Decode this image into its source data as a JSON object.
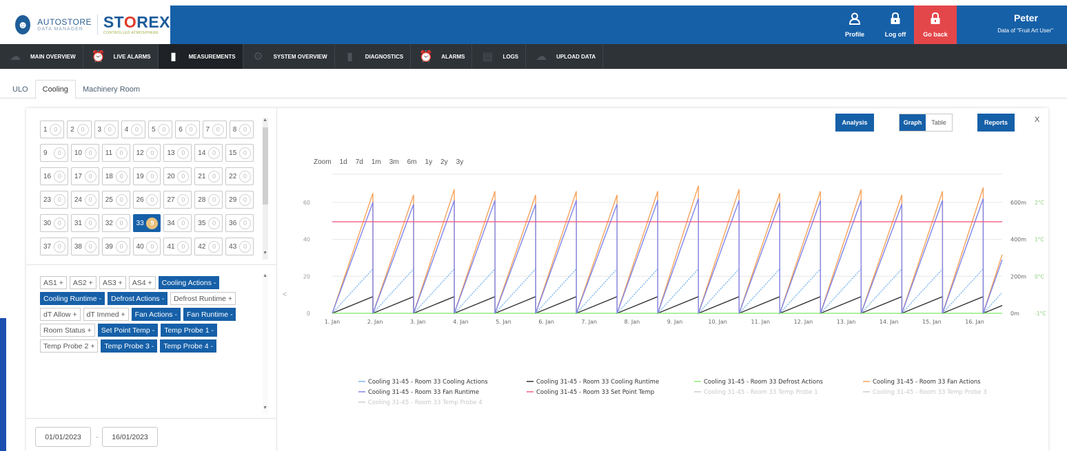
{
  "header": {
    "logo_badge": "☻",
    "logo_main": "AUTOSTORE",
    "logo_sub": "DATA MANAGER",
    "storex_pre": "ST",
    "storex_o": "O",
    "storex_post": "REX",
    "storex_sub": "CONTROLLED ATMOSPHERE",
    "buttons": [
      {
        "label": "Profile",
        "icon": "user-icon"
      },
      {
        "label": "Log off",
        "icon": "lock-icon"
      },
      {
        "label": "Go back",
        "icon": "lock-icon"
      }
    ],
    "user_name": "Peter",
    "user_data": "Data of \"Fruit Art User\"",
    "colors": {
      "brand": "#1660a8",
      "danger": "#e4474a",
      "nav": "#2e3338"
    }
  },
  "nav": [
    {
      "label": "MAIN OVERVIEW",
      "icon": "cloud-icon"
    },
    {
      "label": "LIVE ALARMS",
      "icon": "alarm-clock-icon"
    },
    {
      "label": "MEASUREMENTS",
      "icon": "bar-chart-icon",
      "active": true
    },
    {
      "label": "SYSTEM OVERVIEW",
      "icon": "gear-icon"
    },
    {
      "label": "DIAGNOSTICS",
      "icon": "bar-chart-icon"
    },
    {
      "label": "ALARMS",
      "icon": "alarm-clock-icon"
    },
    {
      "label": "LOGS",
      "icon": "document-icon"
    },
    {
      "label": "UPLOAD DATA",
      "icon": "cloud-upload-icon"
    }
  ],
  "subtabs": [
    {
      "label": "ULO"
    },
    {
      "label": "Cooling",
      "active": true
    },
    {
      "label": "Machinery Room"
    }
  ],
  "rooms": [
    [
      {
        "n": "1",
        "c": "0"
      },
      {
        "n": "2",
        "c": "0"
      },
      {
        "n": "3",
        "c": "0"
      },
      {
        "n": "4",
        "c": "0"
      },
      {
        "n": "5",
        "c": "0"
      },
      {
        "n": "6",
        "c": "0"
      },
      {
        "n": "7",
        "c": "0"
      },
      {
        "n": "8",
        "c": "0"
      }
    ],
    [
      {
        "n": "9",
        "c": "0"
      },
      {
        "n": "10",
        "c": "0"
      },
      {
        "n": "11",
        "c": "0"
      },
      {
        "n": "12",
        "c": "0"
      },
      {
        "n": "13",
        "c": "0"
      },
      {
        "n": "14",
        "c": "0"
      },
      {
        "n": "15",
        "c": "0"
      }
    ],
    [
      {
        "n": "16",
        "c": "0"
      },
      {
        "n": "17",
        "c": "0"
      },
      {
        "n": "18",
        "c": "0"
      },
      {
        "n": "19",
        "c": "0"
      },
      {
        "n": "20",
        "c": "0"
      },
      {
        "n": "21",
        "c": "0"
      },
      {
        "n": "22",
        "c": "0"
      }
    ],
    [
      {
        "n": "23",
        "c": "0"
      },
      {
        "n": "24",
        "c": "0"
      },
      {
        "n": "25",
        "c": "0"
      },
      {
        "n": "26",
        "c": "0"
      },
      {
        "n": "27",
        "c": "0"
      },
      {
        "n": "28",
        "c": "0"
      },
      {
        "n": "29",
        "c": "0"
      }
    ],
    [
      {
        "n": "30",
        "c": "0"
      },
      {
        "n": "31",
        "c": "0"
      },
      {
        "n": "32",
        "c": "0"
      },
      {
        "n": "33",
        "c": "9",
        "selected": true
      },
      {
        "n": "34",
        "c": "0"
      },
      {
        "n": "35",
        "c": "0"
      },
      {
        "n": "36",
        "c": "0"
      }
    ],
    [
      {
        "n": "37",
        "c": "0"
      },
      {
        "n": "38",
        "c": "0"
      },
      {
        "n": "39",
        "c": "0"
      },
      {
        "n": "40",
        "c": "0"
      },
      {
        "n": "41",
        "c": "0"
      },
      {
        "n": "42",
        "c": "0"
      },
      {
        "n": "43",
        "c": "0"
      }
    ],
    [
      {
        "n": "44",
        "c": "0"
      },
      {
        "n": "45",
        "c": "0"
      },
      {
        "n": "46",
        "c": "0"
      },
      {
        "n": "47",
        "c": "0"
      },
      {
        "n": "48",
        "c": "0"
      },
      {
        "n": "49",
        "c": "0"
      },
      {
        "n": "50",
        "c": "0"
      }
    ]
  ],
  "tags": [
    {
      "label": "AS1 +",
      "on": false
    },
    {
      "label": "AS2 +",
      "on": false
    },
    {
      "label": "AS3 +",
      "on": false
    },
    {
      "label": "AS4 +",
      "on": false
    },
    {
      "label": "Cooling Actions -",
      "on": true
    },
    {
      "label": "Cooling Runtime -",
      "on": true
    },
    {
      "label": "Defrost Actions -",
      "on": true
    },
    {
      "label": "Defrost Runtime +",
      "on": false
    },
    {
      "label": "dT Allow +",
      "on": false
    },
    {
      "label": "dT Immed +",
      "on": false
    },
    {
      "label": "Fan Actions -",
      "on": true
    },
    {
      "label": "Fan Runtime -",
      "on": true
    },
    {
      "label": "Room Status +",
      "on": false
    },
    {
      "label": "Set Point Temp -",
      "on": true
    },
    {
      "label": "Temp Probe 1 -",
      "on": true
    },
    {
      "label": "Temp Probe 2 +",
      "on": false
    },
    {
      "label": "Temp Probe 3 -",
      "on": true
    },
    {
      "label": "Temp Probe 4 -",
      "on": true
    }
  ],
  "dates": {
    "from": "01/01/2023",
    "sep": "-",
    "to": "16/01/2023"
  },
  "toolbar": {
    "analysis": "Analysis",
    "graph": "Graph",
    "table": "Table",
    "reports": "Reports",
    "close": "X",
    "collapse": "<"
  },
  "zoom": {
    "label": "Zoom",
    "options": [
      "1d",
      "7d",
      "1m",
      "3m",
      "6m",
      "1y",
      "2y",
      "3y"
    ]
  },
  "chart_data": {
    "type": "line",
    "x_tick_labels": [
      "1. Jan",
      "2. Jan",
      "3. Jan",
      "4. Jan",
      "5. Jan",
      "6. Jan",
      "7. Jan",
      "8. Jan",
      "9. Jan",
      "10. Jan",
      "11. Jan",
      "12. Jan",
      "13. Jan",
      "14. Jan",
      "15. Jan",
      "16. Jan"
    ],
    "y_left_ticks": [
      "0",
      "20",
      "40",
      "60"
    ],
    "y_left_range": [
      0,
      70
    ],
    "y_right_runtime_ticks": [
      "0m",
      "200m",
      "400m",
      "600m"
    ],
    "y_right_temp_ticks": [
      "-1°C",
      "0°C",
      "1°C",
      "2°C"
    ],
    "grid": "horizontal",
    "legend_position": "bottom",
    "cycles": 16,
    "cycle_days": 0.95,
    "series": [
      {
        "name": "Cooling 31-45 - Room 33 Cooling Actions",
        "color": "#7cb5ec",
        "visible": true,
        "peaks": [
          24,
          24,
          24,
          24,
          24,
          24,
          24,
          24,
          24,
          24,
          24,
          24,
          24,
          24,
          24,
          24
        ],
        "style": "dotted"
      },
      {
        "name": "Cooling 31-45 - Room 33 Cooling Runtime",
        "color": "#333333",
        "visible": true,
        "peaks": [
          9,
          9,
          9,
          9,
          9,
          9,
          9,
          9,
          9,
          9,
          9,
          9,
          9,
          9,
          9,
          9
        ]
      },
      {
        "name": "Cooling 31-45 - Room 33 Defrost Actions",
        "color": "#90ed7d",
        "visible": true,
        "constant": 0
      },
      {
        "name": "Cooling 31-45 - Room 33 Fan Actions",
        "color": "#f7a35c",
        "visible": true,
        "peaks": [
          65,
          64,
          67,
          66,
          64,
          66,
          64,
          66,
          69,
          67,
          65,
          66,
          67,
          64,
          66,
          68
        ]
      },
      {
        "name": "Cooling 31-45 - Room 33 Fan Runtime",
        "color": "#8085e9",
        "visible": true,
        "peaks": [
          60,
          59,
          61,
          61,
          59,
          61,
          59,
          61,
          62,
          61,
          60,
          61,
          61,
          59,
          61,
          62
        ]
      },
      {
        "name": "Cooling 31-45 - Room 33 Set Point Temp",
        "color": "#f15c80",
        "visible": true,
        "constant": 49.5
      },
      {
        "name": "Cooling 31-45 - Room 33 Temp Probe 1",
        "color": "#cccccc",
        "visible": false
      },
      {
        "name": "Cooling 31-45 - Room 33 Temp Probe 3",
        "color": "#cccccc",
        "visible": false
      },
      {
        "name": "Cooling 31-45 - Room 33 Temp Probe 4",
        "color": "#cccccc",
        "visible": false
      }
    ]
  }
}
